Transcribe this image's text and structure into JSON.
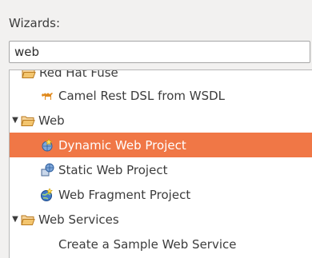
{
  "wizards": {
    "label": "Wizards:",
    "filter_value": "web"
  },
  "tree": {
    "clipped_item": "Red Hat Fuse",
    "items": [
      {
        "label": "Camel Rest DSL from WSDL",
        "icon": "camel-icon"
      },
      {
        "label": "Web",
        "icon": "folder-open-icon",
        "expanded": true
      },
      {
        "label": "Dynamic Web Project",
        "icon": "dynamic-web-project-icon",
        "selected": true
      },
      {
        "label": "Static Web Project",
        "icon": "static-web-project-icon"
      },
      {
        "label": "Web Fragment Project",
        "icon": "web-fragment-project-icon"
      },
      {
        "label": "Web Services",
        "icon": "folder-open-icon",
        "expanded": true
      },
      {
        "label": "Create a Sample Web Service",
        "icon": ""
      }
    ]
  },
  "colors": {
    "selection": "#f07746",
    "folder": "#e8a33d"
  }
}
